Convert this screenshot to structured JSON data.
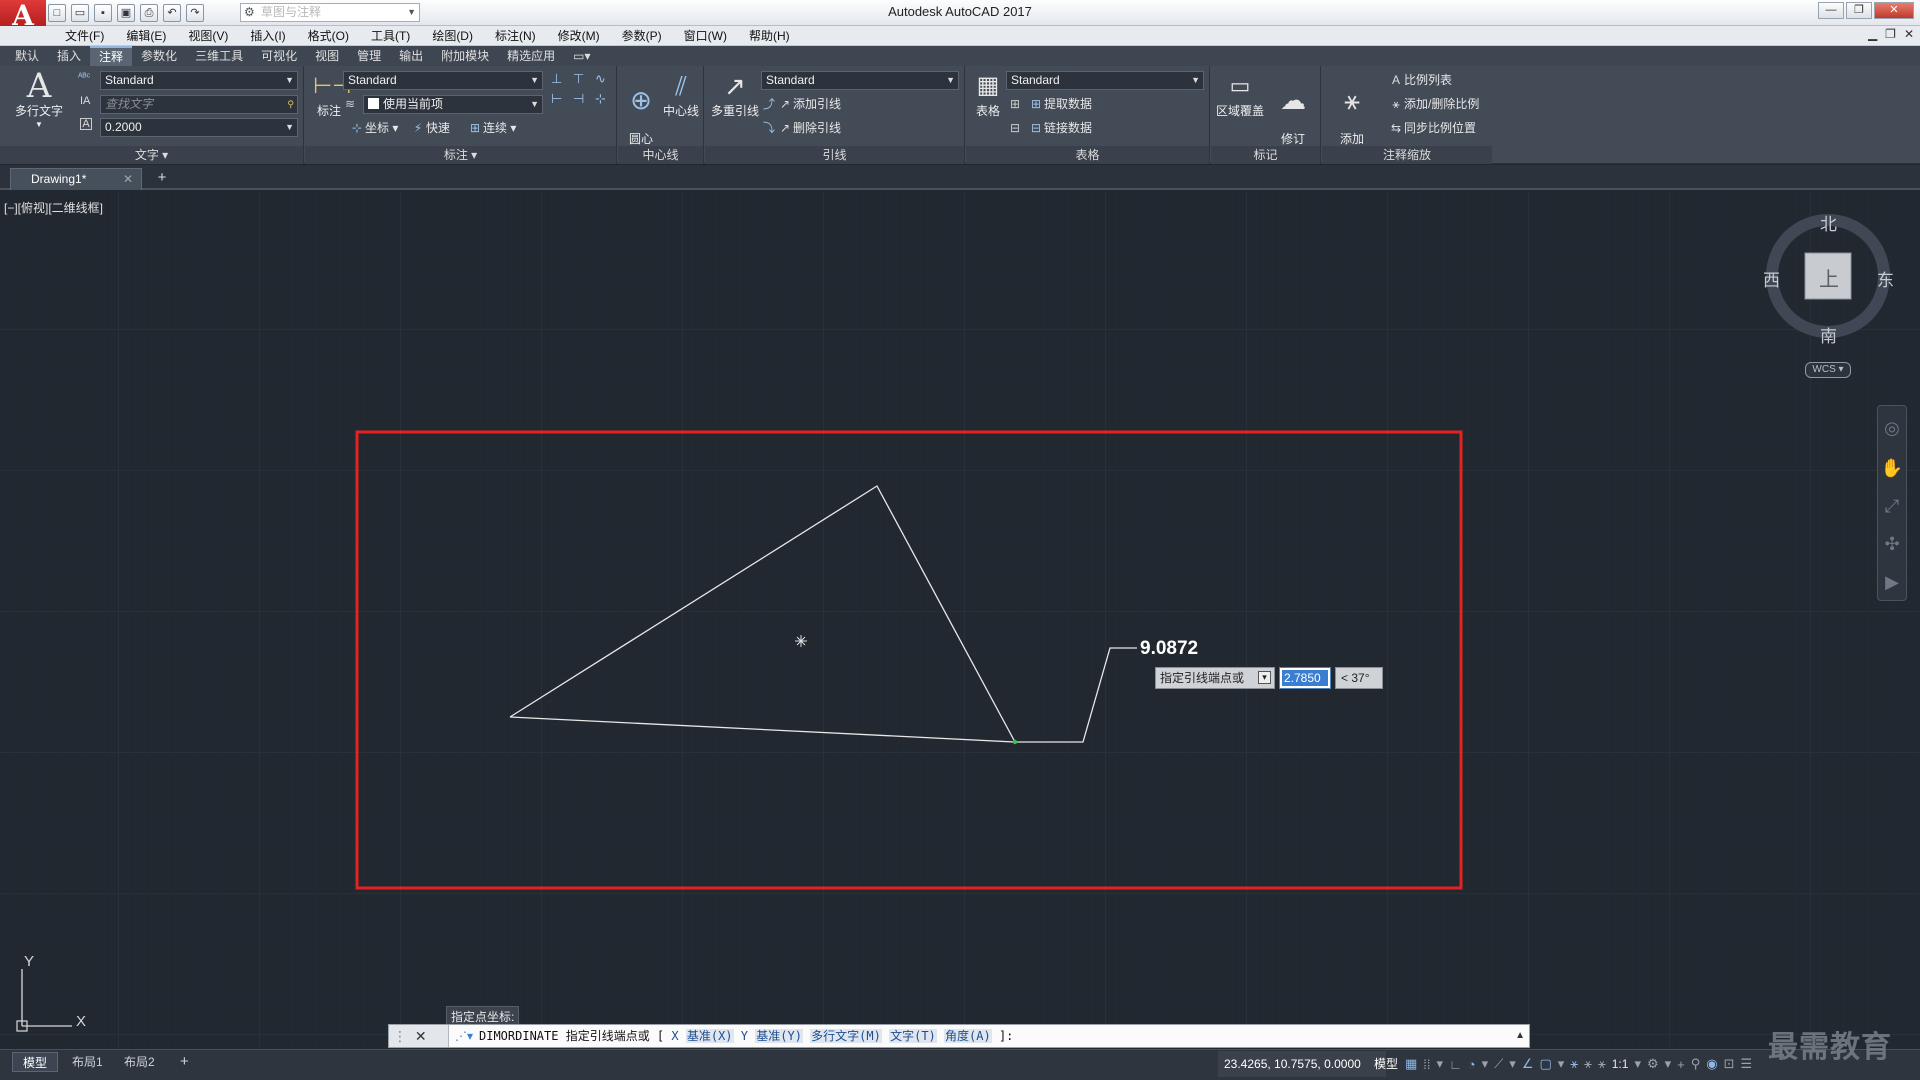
{
  "app": {
    "title": "Autodesk AutoCAD 2017",
    "logo": "A",
    "workspace": "草图与注释"
  },
  "window_controls": [
    "—",
    "❐",
    "✕"
  ],
  "menu": [
    "文件(F)",
    "编辑(E)",
    "视图(V)",
    "插入(I)",
    "格式(O)",
    "工具(T)",
    "绘图(D)",
    "标注(N)",
    "修改(M)",
    "参数(P)",
    "窗口(W)",
    "帮助(H)"
  ],
  "ribbon_tabs": [
    "默认",
    "插入",
    "注释",
    "参数化",
    "三维工具",
    "可视化",
    "视图",
    "管理",
    "输出",
    "附加模块",
    "精选应用"
  ],
  "active_tab": "注释",
  "ribbon": {
    "text_panel": {
      "title": "文字",
      "mtext_label": "多行文字",
      "style": "Standard",
      "find_placeholder": "查找文字",
      "height": "0.2000"
    },
    "dim_panel": {
      "title": "标注",
      "dim_label": "标注",
      "style": "Standard",
      "layer": "使用当前项",
      "ordinate": "坐标",
      "quick": "快速",
      "continue": "连续"
    },
    "centerline_panel": {
      "title": "中心线",
      "center_mark": "圆心\n标记",
      "centerline": "中心线"
    },
    "leader_panel": {
      "title": "引线",
      "mleader": "多重引线",
      "style": "Standard",
      "add_leader": "添加引线",
      "remove_leader": "删除引线"
    },
    "table_panel": {
      "title": "表格",
      "table": "表格",
      "style": "Standard",
      "extract": "提取数据",
      "link": "链接数据"
    },
    "markup_panel": {
      "title": "标记",
      "wipeout": "区域覆盖",
      "revcloud": "修订\n云线"
    },
    "scale_panel": {
      "title": "注释缩放",
      "add_scale": "添加\n当前比例",
      "scale_list": "比例列表",
      "add_del_scale": "添加/删除比例",
      "sync_scale": "同步比例位置"
    }
  },
  "doc_tab": "Drawing1*",
  "viewport_label": "[−][俯视][二维线框]",
  "viewcube": {
    "n": "北",
    "s": "南",
    "e": "东",
    "w": "西",
    "face": "上",
    "wcs": "WCS"
  },
  "drawing": {
    "dimension_value": "9.0872"
  },
  "dynamic_input": {
    "prompt": "指定引线端点或",
    "value": "2.7850",
    "angle": "< 37°"
  },
  "ucs": {
    "x": "X",
    "y": "Y"
  },
  "command": {
    "hint": "指定点坐标:",
    "text_prefix": "DIMORDINATE 指定引线端点或 [",
    "options": [
      {
        "key": "X",
        "label": "基准(X)"
      },
      {
        "key": "Y",
        "label": "基准(Y)"
      },
      {
        "key": "",
        "label": "多行文字(M)"
      },
      {
        "key": "",
        "label": "文字(T)"
      },
      {
        "key": "",
        "label": "角度(A)"
      }
    ],
    "text_suffix": "]:"
  },
  "layout_tabs": [
    "模型",
    "布局1",
    "布局2"
  ],
  "status": {
    "coords": "23.4265, 10.7575, 0.0000",
    "model": "模型",
    "scale": "1:1"
  },
  "watermark": "最需教育",
  "colors": {
    "canvas_bg": "#212830",
    "highlight_rect": "#e52121",
    "ribbon_bg": "#434b57"
  }
}
